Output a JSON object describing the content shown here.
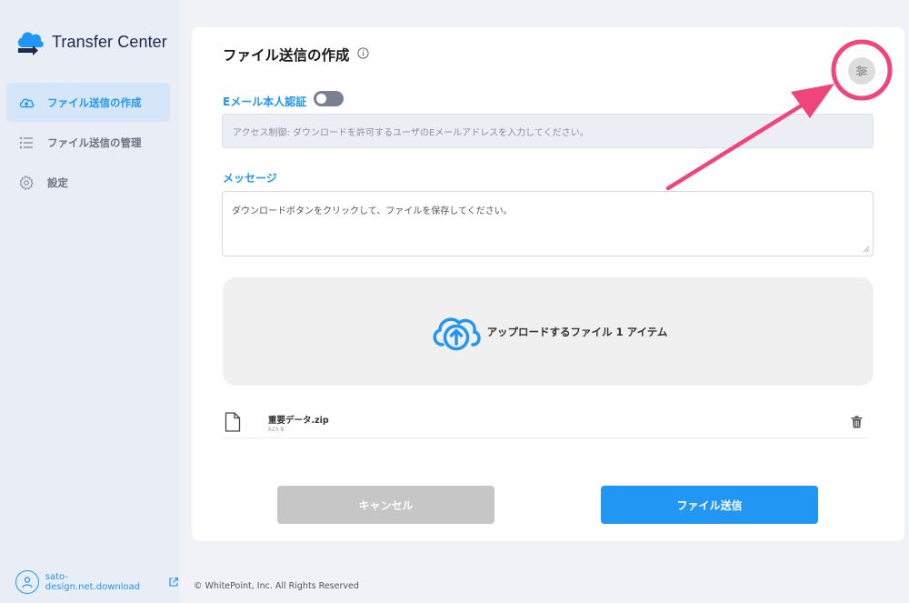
{
  "app": {
    "logo_text": "Transfer Center"
  },
  "sidebar": {
    "items": [
      {
        "label": "ファイル送信の作成",
        "icon": "cloud-upload-icon",
        "active": true
      },
      {
        "label": "ファイル送信の管理",
        "icon": "list-icon",
        "active": false
      },
      {
        "label": "設定",
        "icon": "gear-icon",
        "active": false
      }
    ],
    "user": {
      "name": "sato-design.net.download",
      "icon": "user-icon",
      "link_icon": "external-link-icon"
    }
  },
  "main": {
    "title": "ファイル送信の作成",
    "email_auth": {
      "label": "Eメール本人認証",
      "enabled": false,
      "placeholder": "アクセス制御: ダウンロードを許可するユーザのEメールアドレスを入力してください。"
    },
    "message": {
      "label": "メッセージ",
      "value": "ダウンロードボタンをクリックして、ファイルを保存してください。"
    },
    "dropzone": {
      "text": "アップロードするファイル 1 アイテム"
    },
    "files": [
      {
        "name": "重要データ.zip",
        "size": "623 B"
      }
    ],
    "buttons": {
      "cancel": "キャンセル",
      "send": "ファイル送信"
    }
  },
  "footer": {
    "copyright": "© WhitePoint, Inc. All Rights Reserved"
  },
  "colors": {
    "accent": "#2196f3",
    "annotation": "#f0457a",
    "sidebar_bg": "#e8edf6"
  }
}
